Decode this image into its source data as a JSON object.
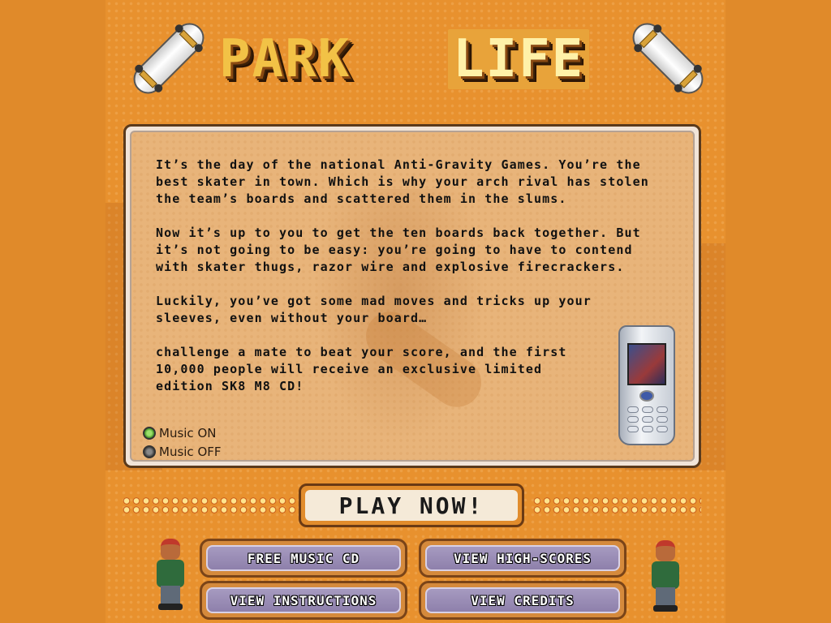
{
  "title": {
    "word_1": "PARK",
    "word_2": "LIFE"
  },
  "story": {
    "paragraph_1": "It’s the day of the national Anti-Gravity Games. You’re the\nbest skater in town. Which is why your arch rival has stolen\nthe team’s boards and scattered them in the slums.",
    "paragraph_2": "Now it’s up to you to get the ten boards back together. But\nit’s not going to be easy: you’re going to have to contend\nwith skater thugs, razor wire and explosive firecrackers.",
    "paragraph_3": "Luckily, you’ve got some mad moves and tricks up your\nsleeves, even without your board…",
    "paragraph_4": "challenge a mate to beat your score, and the first\n10,000 people will receive an exclusive limited\nedition SK8 M8 CD!"
  },
  "music": {
    "on_label": "Music ON",
    "off_label": "Music OFF",
    "selected": "on"
  },
  "play_now": {
    "label": "PLAY NOW!"
  },
  "nav": {
    "free_music": "FREE MUSIC CD",
    "high_scores": "VIEW HIGH-SCORES",
    "instructions": "VIEW INSTRUCTIONS",
    "credits": "VIEW CREDITS"
  },
  "colors": {
    "background": "#e08a2a",
    "title_primary": "#f2c246",
    "title_secondary": "#fff1a8",
    "button_purple": "#8e80ab",
    "music_on": "#3d8c22"
  },
  "icons": [
    "skateboard-icon",
    "mobile-phone-icon",
    "skater-character-icon",
    "radio-on-icon",
    "radio-off-icon"
  ]
}
